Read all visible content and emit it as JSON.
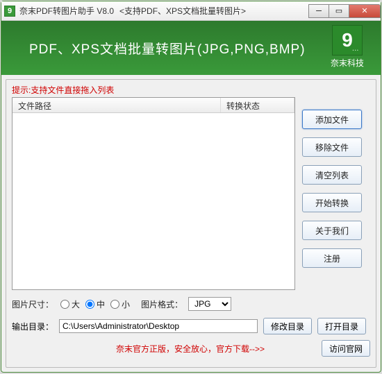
{
  "titlebar": {
    "app_icon_letter": "9",
    "title": "奈末PDF转图片助手 V8.0",
    "subtitle": "<支持PDF、XPS文档批量转图片>"
  },
  "banner": {
    "title": "PDF、XPS文档批量转图片(JPG,PNG,BMP)",
    "logo_letter": "9",
    "logo_dots": "...",
    "company": "奈末科技"
  },
  "hint": "提示:支持文件直接拖入列表",
  "table": {
    "col1": "文件路径",
    "col2": "转换状态"
  },
  "buttons": {
    "add_file": "添加文件",
    "remove_file": "移除文件",
    "clear_list": "清空列表",
    "start_convert": "开始转换",
    "about_us": "关于我们",
    "register": "注册"
  },
  "options": {
    "size_label": "图片尺寸：",
    "size_large": "大",
    "size_medium": "中",
    "size_small": "小",
    "format_label": "图片格式：",
    "format_selected": "JPG"
  },
  "output": {
    "label": "输出目录：",
    "path": "C:\\Users\\Administrator\\Desktop",
    "modify": "修改目录",
    "open": "打开目录"
  },
  "footer": {
    "text": "奈末官方正版，安全放心，官方下载-->>",
    "visit": "访问官网"
  }
}
